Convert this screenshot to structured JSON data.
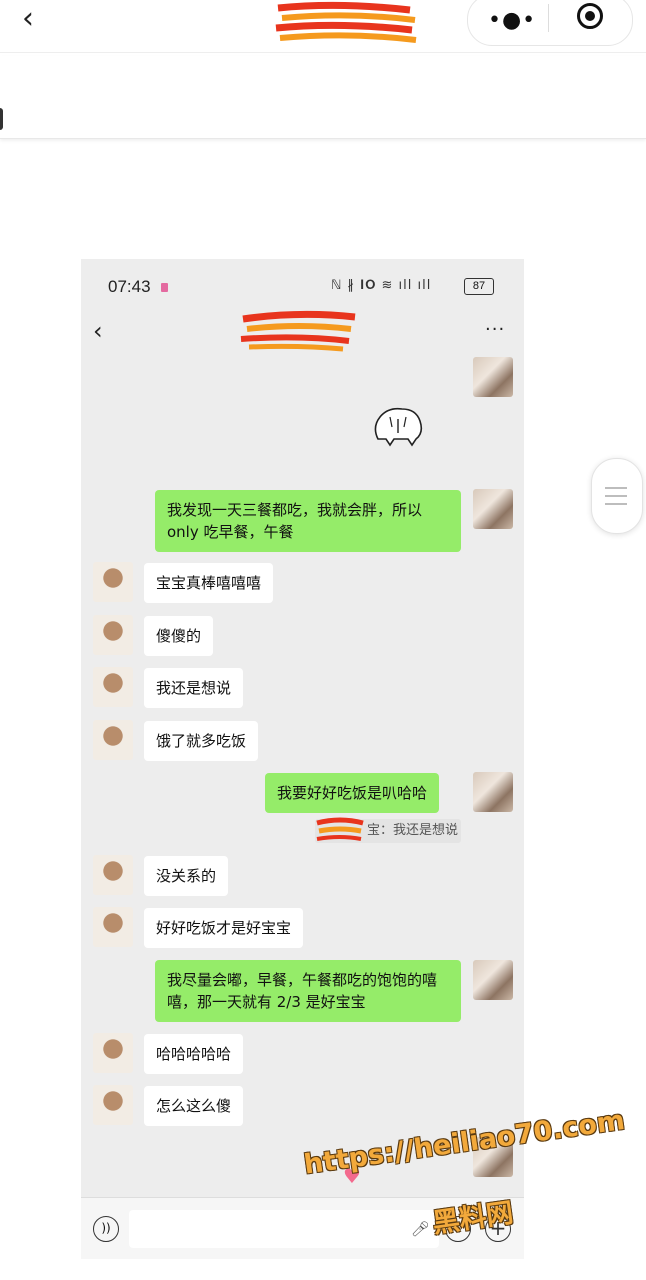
{
  "outer": {
    "back_icon": "chevron-left-icon",
    "more_icon": "more-dots-icon",
    "close_icon": "target-icon"
  },
  "phone": {
    "status": {
      "time": "07:43",
      "icons": "ℕ ∦ 𝐈𝐎 ≋ ıll ıll",
      "battery": "87"
    },
    "header": {
      "back_icon": "chevron-left-icon",
      "more_label": "···"
    }
  },
  "messages": [
    {
      "side": "me",
      "text": "我发现一天三餐都吃，我就会胖，所以only 吃早餐，午餐"
    },
    {
      "side": "them",
      "text": "宝宝真棒嘻嘻嘻"
    },
    {
      "side": "them",
      "text": "傻傻的"
    },
    {
      "side": "them",
      "text": "我还是想说"
    },
    {
      "side": "them",
      "text": "饿了就多吃饭"
    },
    {
      "side": "me",
      "text": "我要好好吃饭是叭哈哈"
    },
    {
      "side": "them",
      "text": "没关系的"
    },
    {
      "side": "them",
      "text": "好好吃饭才是好宝宝"
    },
    {
      "side": "me",
      "text": "我尽量会嘟，早餐，午餐都吃的饱饱的嘻嘻，那一天就有 2/3 是好宝宝"
    },
    {
      "side": "them",
      "text": "哈哈哈哈哈"
    },
    {
      "side": "them",
      "text": "怎么这么傻"
    }
  ],
  "quote": {
    "text": "宝：我还是想说"
  },
  "input_bar": {
    "voice_icon": "voice-icon",
    "mic_icon": "mic-icon",
    "emoji_icon": "emoji-icon",
    "plus_label": "+"
  },
  "watermark": {
    "url": "https://heiliao70.com",
    "name": "黑料网"
  },
  "colors": {
    "my_bubble": "#95ec69",
    "their_bubble": "#ffffff",
    "chat_bg": "#ededed",
    "watermark": "#f2a93b"
  }
}
